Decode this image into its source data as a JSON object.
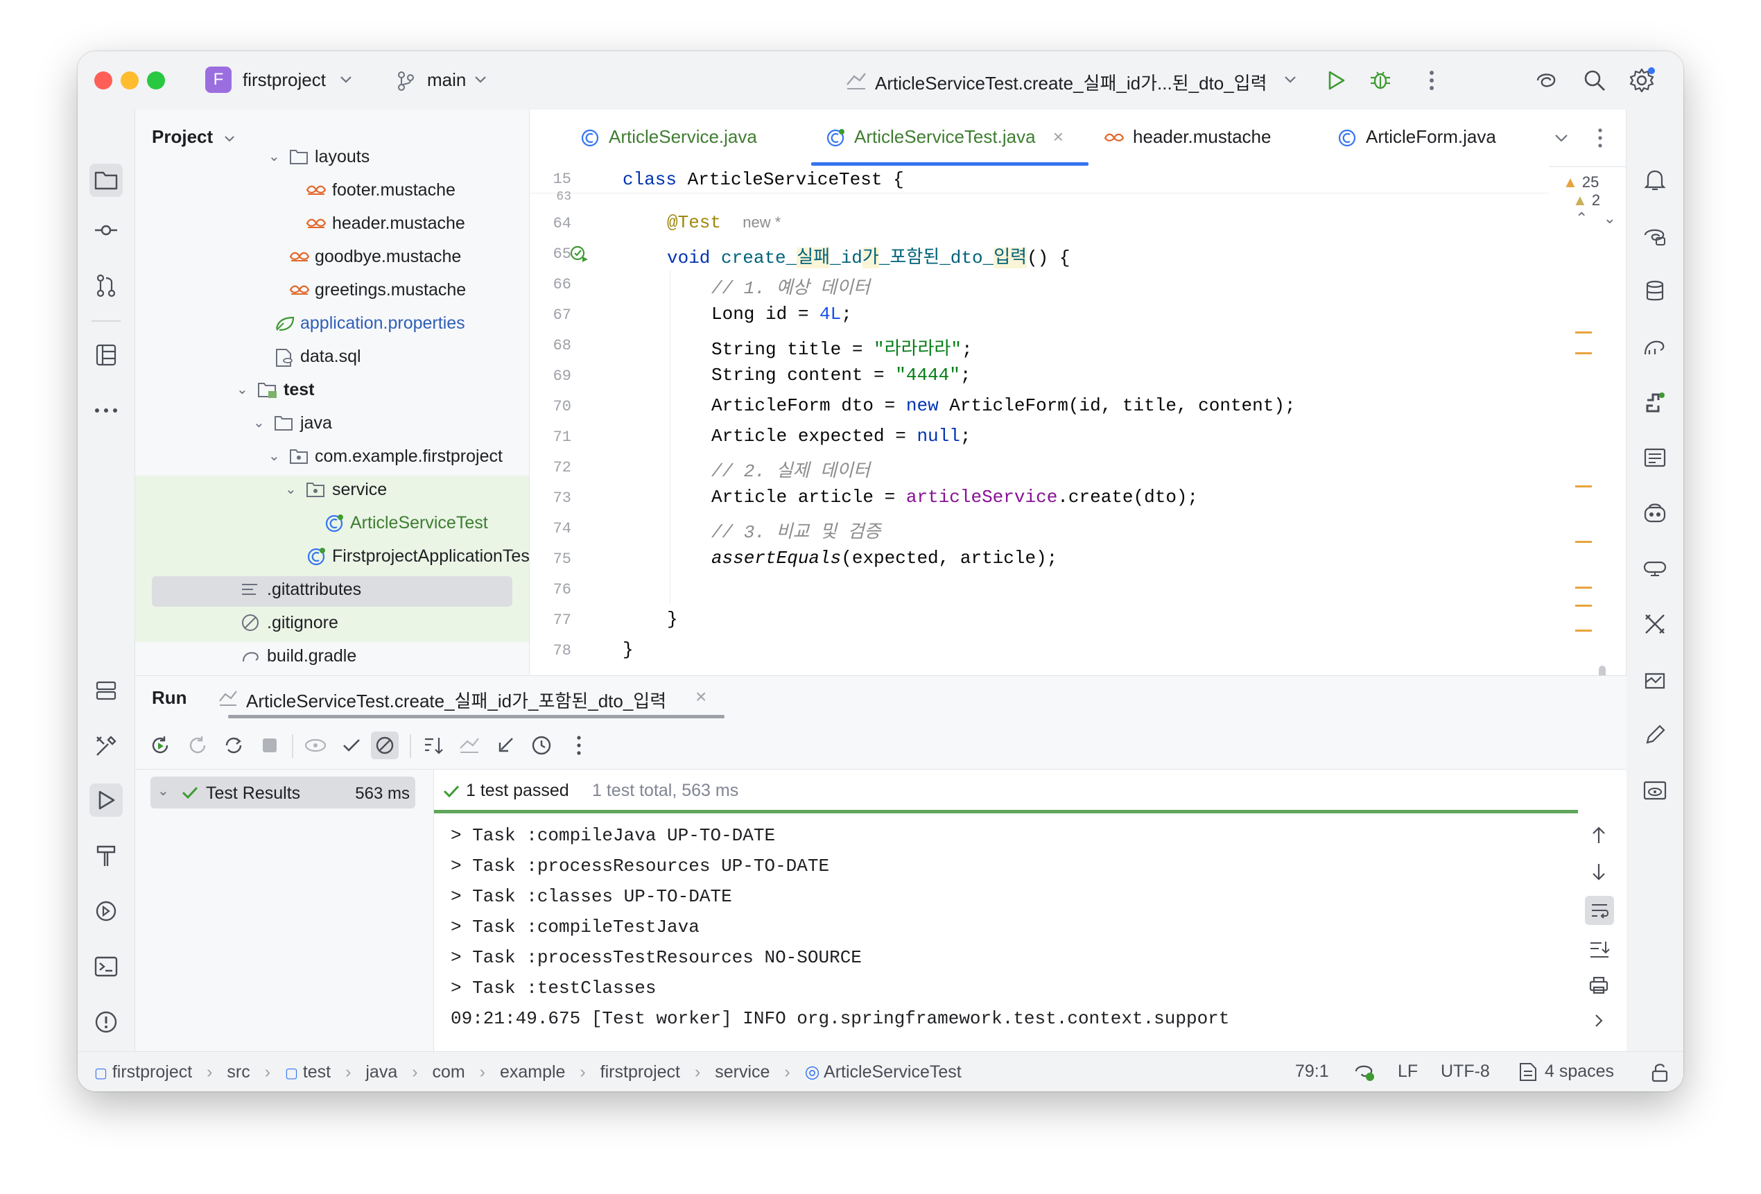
{
  "titlebar": {
    "project_initial": "F",
    "project_name": "firstproject",
    "branch": "main",
    "run_config": "ArticleServiceTest.create_실패_id가...된_dto_입력"
  },
  "project_panel": {
    "title": "Project",
    "items": [
      {
        "label": "layouts",
        "type": "folder"
      },
      {
        "label": "footer.mustache",
        "type": "mustache"
      },
      {
        "label": "header.mustache",
        "type": "mustache"
      },
      {
        "label": "goodbye.mustache",
        "type": "mustache"
      },
      {
        "label": "greetings.mustache",
        "type": "mustache"
      },
      {
        "label": "application.properties",
        "type": "properties"
      },
      {
        "label": "data.sql",
        "type": "sql"
      },
      {
        "label": "test",
        "type": "folder"
      },
      {
        "label": "java",
        "type": "folder"
      },
      {
        "label": "com.example.firstproject",
        "type": "package"
      },
      {
        "label": "service",
        "type": "package"
      },
      {
        "label": "ArticleServiceTest",
        "type": "testclass"
      },
      {
        "label": "FirstprojectApplicationTes",
        "type": "testclass"
      },
      {
        "label": ".gitattributes",
        "type": "file"
      },
      {
        "label": ".gitignore",
        "type": "ignore"
      },
      {
        "label": "build.gradle",
        "type": "gradle"
      }
    ]
  },
  "editor": {
    "tabs": [
      {
        "label": "ArticleService.java"
      },
      {
        "label": "ArticleServiceTest.java"
      },
      {
        "label": "header.mustache"
      },
      {
        "label": "ArticleForm.java"
      }
    ],
    "sticky_line_no": "15",
    "sticky_class_kw": "class",
    "sticky_class_name": "ArticleServiceTest {",
    "warnings": "25",
    "weak_warnings": "2",
    "new_hint": "new *",
    "lines": [
      {
        "no": "63"
      },
      {
        "no": "64",
        "ann": "@Test"
      },
      {
        "no": "65",
        "kw": "void",
        "name_a": "create_",
        "name_b": "실패",
        "name_c": "_id",
        "name_d": "가",
        "name_e": "_포함된_dto_",
        "name_f": "입력",
        "tail": "() {"
      },
      {
        "no": "66",
        "comment": "// 1. 예상 데이터"
      },
      {
        "no": "67",
        "a": "Long id = ",
        "num": "4L",
        "b": ";"
      },
      {
        "no": "68",
        "a": "String title = ",
        "str": "\"라라라라\"",
        "b": ";"
      },
      {
        "no": "69",
        "a": "String content = ",
        "str": "\"4444\"",
        "b": ";"
      },
      {
        "no": "70",
        "a": "ArticleForm dto = ",
        "kw": "new",
        "b": " ArticleForm(id, title, content);"
      },
      {
        "no": "71",
        "a": "Article expected = ",
        "kw": "null",
        "b": ";"
      },
      {
        "no": "72",
        "comment": "// 2. 실제 데이터"
      },
      {
        "no": "73",
        "a": "Article article = ",
        "fld": "articleService",
        "b": ".create(dto);"
      },
      {
        "no": "74",
        "comment": "// 3. 비교 및 검증"
      },
      {
        "no": "75",
        "ital": "assertEquals",
        "b": "(expected, article);"
      },
      {
        "no": "76"
      },
      {
        "no": "77",
        "a": "}"
      },
      {
        "no": "78",
        "a": "}"
      }
    ]
  },
  "run_panel": {
    "title": "Run",
    "tab_label": "ArticleServiceTest.create_실패_id가_포함된_dto_입력",
    "tree_root": "Test Results",
    "tree_root_time": "563 ms",
    "summary_passed": "1 test passed",
    "summary_total": "1 test total, 563 ms",
    "console": [
      "> Task :compileJava UP-TO-DATE",
      "> Task :processResources UP-TO-DATE",
      "> Task :classes UP-TO-DATE",
      "> Task :compileTestJava",
      "> Task :processTestResources NO-SOURCE",
      "> Task :testClasses",
      "09:21:49.675 [Test worker] INFO org.springframework.test.context.support"
    ]
  },
  "statusbar": {
    "breadcrumbs": [
      "firstproject",
      "src",
      "test",
      "java",
      "com",
      "example",
      "firstproject",
      "service",
      "ArticleServiceTest"
    ],
    "position": "79:1",
    "line_sep": "LF",
    "encoding": "UTF-8",
    "indent": "4 spaces"
  },
  "colors": {
    "accent": "#3574f0",
    "success": "#3f9b33",
    "warning": "#e8a33e"
  }
}
